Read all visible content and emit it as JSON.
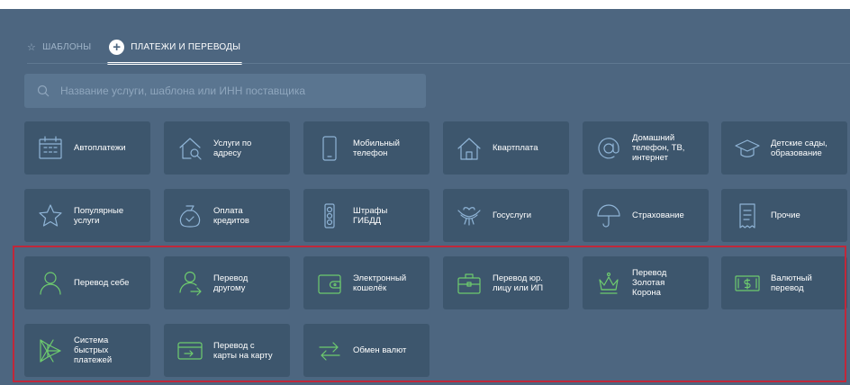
{
  "tabs": {
    "templates": "ШАБЛОНЫ",
    "payments": "ПЛАТЕЖИ И ПЕРЕВОДЫ"
  },
  "search": {
    "placeholder": "Название услуги, шаблона или ИНН поставщика",
    "icon": "search-icon"
  },
  "categories": [
    {
      "label": "Автоплатежи",
      "icon": "calendar-icon"
    },
    {
      "label": "Услуги по\nадресу",
      "icon": "house-search-icon"
    },
    {
      "label": "Мобильный\nтелефон",
      "icon": "mobile-phone-icon"
    },
    {
      "label": "Квартплата",
      "icon": "house-icon"
    },
    {
      "label": "Домашний\nтелефон, ТВ,\nинтернет",
      "icon": "at-sign-icon"
    },
    {
      "label": "Детские сады,\nобразование",
      "icon": "graduation-cap-icon"
    },
    {
      "label": "Популярные\nуслуги",
      "icon": "star-icon"
    },
    {
      "label": "Оплата\nкредитов",
      "icon": "money-bag-icon"
    },
    {
      "label": "Штрафы\nГИБДД",
      "icon": "traffic-light-icon"
    },
    {
      "label": "Госуслуги",
      "icon": "eagle-emblem-icon"
    },
    {
      "label": "Страхование",
      "icon": "umbrella-icon"
    },
    {
      "label": "Прочие",
      "icon": "receipt-icon"
    }
  ],
  "transfers": [
    {
      "label": "Перевод себе",
      "icon": "person-icon"
    },
    {
      "label": "Перевод\nдругому",
      "icon": "person-arrow-icon"
    },
    {
      "label": "Электронный\nкошелёк",
      "icon": "wallet-icon"
    },
    {
      "label": "Перевод юр.\nлицу или ИП",
      "icon": "briefcase-icon"
    },
    {
      "label": "Перевод\nЗолотая\nКорона",
      "icon": "crown-icon"
    },
    {
      "label": "Валютный\nперевод",
      "icon": "banknote-icon"
    },
    {
      "label": "Система\nбыстрых\nплатежей",
      "icon": "sbp-logo-icon"
    },
    {
      "label": "Перевод с\nкарты на карту",
      "icon": "card-transfer-icon"
    },
    {
      "label": "Обмен валют",
      "icon": "exchange-arrows-icon"
    }
  ],
  "colors": {
    "background": "#4d6680",
    "tile": "#3d566d",
    "icon_stroke": "#8fb4d6",
    "transfer_icon_stroke": "#6ecb6e",
    "highlight": "#c0283a"
  }
}
